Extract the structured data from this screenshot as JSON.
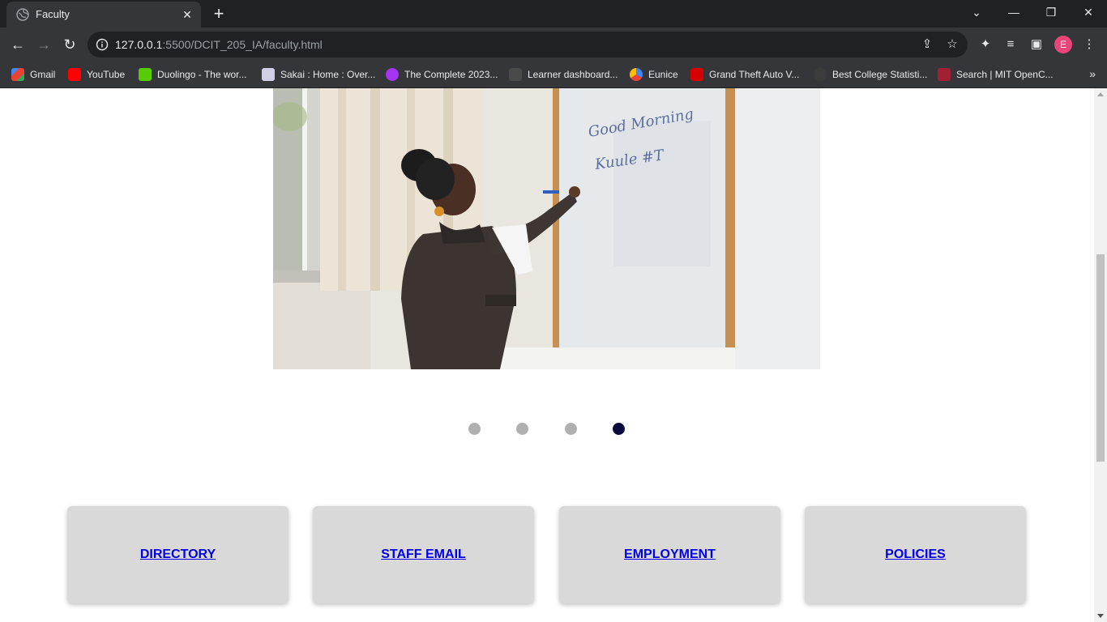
{
  "browser": {
    "tab": {
      "title": "Faculty"
    },
    "url": {
      "host": "127.0.0.1",
      "path": ":5500/DCIT_205_IA/faculty.html"
    },
    "avatar_letter": "E",
    "bookmarks": [
      {
        "label": "Gmail",
        "icon": "gmail-icon",
        "color": "#ea4335"
      },
      {
        "label": "YouTube",
        "icon": "youtube-icon",
        "color": "#ff0000"
      },
      {
        "label": "Duolingo - The wor...",
        "icon": "duolingo-icon",
        "color": "#58cc02"
      },
      {
        "label": "Sakai : Home : Over...",
        "icon": "sakai-icon",
        "color": "#cfcfe8"
      },
      {
        "label": "The Complete 2023...",
        "icon": "udemy-icon",
        "color": "#a435f0"
      },
      {
        "label": "Learner dashboard...",
        "icon": "alx-icon",
        "color": "#4a4a4a"
      },
      {
        "label": "Eunice",
        "icon": "chromium-icon",
        "color": "#4285f4"
      },
      {
        "label": "Grand Theft Auto V...",
        "icon": "gta-icon",
        "color": "#d50000"
      },
      {
        "label": "Best College Statisti...",
        "icon": "globe-icon",
        "color": "#3c3c3c"
      },
      {
        "label": "Search | MIT OpenC...",
        "icon": "mit-ocw-icon",
        "color": "#a31f34"
      }
    ]
  },
  "page": {
    "carousel": {
      "image_alt": "Teacher writing on whiteboard",
      "board_text": [
        "Good Morning",
        "Kuule #T"
      ],
      "slide_count": 4,
      "active_index": 3
    },
    "links": [
      {
        "label": "DIRECTORY"
      },
      {
        "label": "STAFF EMAIL"
      },
      {
        "label": "EMPLOYMENT"
      },
      {
        "label": "POLICIES"
      }
    ]
  }
}
